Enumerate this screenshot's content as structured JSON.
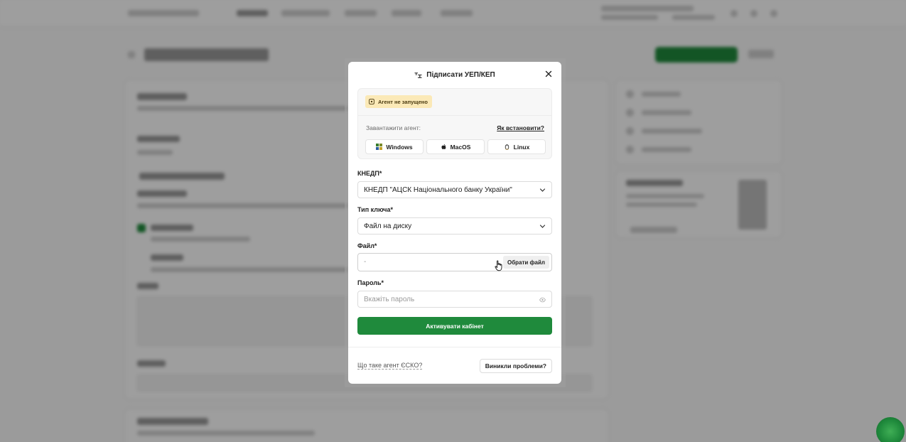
{
  "modal": {
    "title": "Підписати УЕП/КЕП",
    "agent": {
      "status_badge": "Агент не запущено",
      "download_label": "Завантажити агент:",
      "how_to_install": "Як встановити?",
      "os_buttons": [
        {
          "label": "Windows",
          "icon": "windows-icon"
        },
        {
          "label": "MacOS",
          "icon": "apple-icon"
        },
        {
          "label": "Linux",
          "icon": "linux-icon"
        }
      ]
    },
    "kednp": {
      "label": "КНЕДП*",
      "value": "КНЕДП \"АЦСК Національного банку України\""
    },
    "key_type": {
      "label": "Тип ключа*",
      "value": "Файл на диску"
    },
    "file": {
      "label": "Файл*",
      "value": "-",
      "button": "Обрати файл"
    },
    "password": {
      "label": "Пароль*",
      "placeholder": "Вкажіть пароль"
    },
    "submit_button": "Активувати кабінет",
    "footer": {
      "what_is_agent": "Що таке агент ЄСКО?",
      "problems_button": "Виникли проблеми?"
    }
  },
  "colors": {
    "primary": "#1f8a3c",
    "badge_bg": "#fbe9b7",
    "overlay": "rgba(0,0,0,0.38)"
  }
}
